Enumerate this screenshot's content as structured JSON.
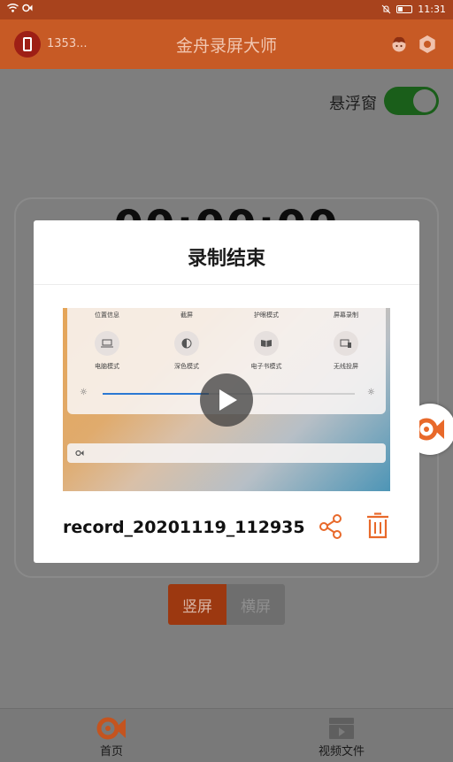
{
  "status_bar": {
    "time": "11:31"
  },
  "header": {
    "device_id": "1353...",
    "app_title": "金舟录屏大师",
    "icons": [
      "phone-icon",
      "avatar-icon",
      "gear-icon"
    ]
  },
  "main": {
    "float_window_label": "悬浮窗",
    "float_window_enabled": true,
    "timer": "00:00:00",
    "orientation_portrait": "竖屏",
    "orientation_landscape": "横屏",
    "orientation_selected": "竖屏"
  },
  "dialog": {
    "title": "录制结束",
    "file_name": "record_20201119_112935",
    "preview": {
      "top_labels": [
        "位置信息",
        "截屏",
        "护眼模式",
        "屏幕录制"
      ],
      "tile_labels": [
        "电脑模式",
        "深色模式",
        "电子书模式",
        "无线投屏"
      ],
      "brightness_fraction": 0.42
    }
  },
  "bottom_nav": {
    "home_label": "首页",
    "videos_label": "视频文件"
  },
  "colors": {
    "accent": "#e8692a",
    "header_bg": "#c75a25",
    "toggle_on": "#1a5e1a"
  }
}
